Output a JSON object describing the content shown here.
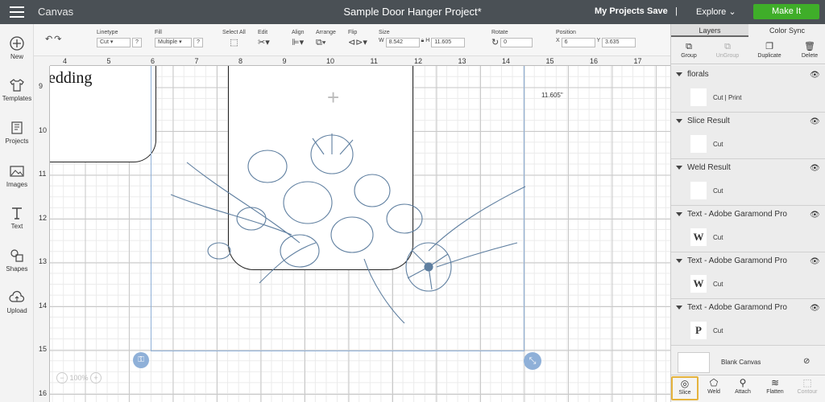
{
  "app": {
    "title": "Canvas",
    "doc_title": "Sample Door Hanger Project*"
  },
  "topnav": {
    "my_projects": "My Projects",
    "save": "Save",
    "divider": "|",
    "explore": "Explore",
    "make_it": "Make It"
  },
  "sidebar": [
    {
      "label": "New"
    },
    {
      "label": "Templates"
    },
    {
      "label": "Projects"
    },
    {
      "label": "Images"
    },
    {
      "label": "Text"
    },
    {
      "label": "Shapes"
    },
    {
      "label": "Upload"
    }
  ],
  "toolbar": {
    "linetype": {
      "label": "Linetype",
      "value": "Cut"
    },
    "fill": {
      "label": "Fill",
      "value": "Multiple"
    },
    "select_all": "Select All",
    "edit": "Edit",
    "align": "Align",
    "arrange": "Arrange",
    "flip": "Flip",
    "size": {
      "label": "Size",
      "w_label": "W",
      "w": "8.542",
      "h_label": "H",
      "h": "11.605"
    },
    "rotate": {
      "label": "Rotate",
      "value": "0"
    },
    "position": {
      "label": "Position",
      "x_label": "X",
      "x": "6",
      "y_label": "Y",
      "y": "3.635"
    }
  },
  "ruler": {
    "top": [
      "4",
      "5",
      "6",
      "7",
      "8",
      "9",
      "10",
      "11",
      "12",
      "13",
      "14",
      "15",
      "16",
      "17"
    ],
    "left": [
      "9",
      "10",
      "11",
      "12",
      "13",
      "14",
      "15",
      "16"
    ]
  },
  "canvas": {
    "doc_text": "edding",
    "dimension_label": "11.605\"",
    "zoom": "100%"
  },
  "panel": {
    "tabs": [
      "Layers",
      "Color Sync"
    ],
    "tools": [
      "Group",
      "UnGroup",
      "Duplicate",
      "Delete"
    ],
    "layers": [
      {
        "name": "florals",
        "op": "Cut  |  Print",
        "thumb": ""
      },
      {
        "name": "Slice Result",
        "op": "Cut",
        "thumb": ""
      },
      {
        "name": "Weld Result",
        "op": "Cut",
        "thumb": ""
      },
      {
        "name": "Text - Adobe Garamond Pro",
        "op": "Cut",
        "thumb": "W"
      },
      {
        "name": "Text - Adobe Garamond Pro",
        "op": "Cut",
        "thumb": "W"
      },
      {
        "name": "Text - Adobe Garamond Pro",
        "op": "Cut",
        "thumb": "P"
      }
    ],
    "blank_canvas": "Blank Canvas",
    "bottom_tools": [
      "Slice",
      "Weld",
      "Attach",
      "Flatten",
      "Contour"
    ]
  },
  "colors": {
    "accent_green": "#3fae29",
    "selection_blue": "#8fb0d8",
    "floral_blue": "#5f7fa0",
    "highlight": "#e5b33d"
  }
}
